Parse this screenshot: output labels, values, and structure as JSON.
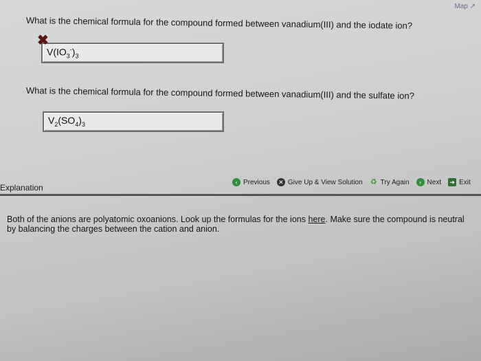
{
  "header": {
    "map_label": "Map"
  },
  "questions": [
    {
      "prompt": "What is the chemical formula for the compound formed between vanadium(III) and the iodate ion?",
      "answer": {
        "base": "V(IO",
        "sub1": "3",
        "sup": "-",
        "mid": ")",
        "sub2": "3"
      },
      "status": "incorrect"
    },
    {
      "prompt": "What is the chemical formula for the compound formed between vanadium(III) and the sulfate ion?",
      "answer": {
        "base": "V",
        "sub1": "2",
        "mid": "(SO",
        "sub2": "4",
        "end": ")",
        "sub3": "3"
      },
      "status": "unanswered"
    }
  ],
  "toolbar": {
    "previous_label": "Previous",
    "give_up_label": "Give Up & View Solution",
    "try_again_label": "Try Again",
    "next_label": "Next",
    "exit_label": "Exit"
  },
  "explanation": {
    "heading": "Explanation",
    "text_before_link": "Both of the anions are polyatomic oxoanions. Look up the formulas for the ions ",
    "link_text": "here",
    "text_after_link": ". Make sure the compound is neutral by balancing the charges between the cation and anion."
  },
  "colors": {
    "previous_icon": "#2f8f3a",
    "give_up_icon": "#333333",
    "try_again_icon": "#3a8f2a",
    "next_icon": "#2f8f3a",
    "exit_icon": "#2f6f2f"
  },
  "icons": {
    "previous": "arrow-left-circle-icon",
    "give_up": "x-circle-icon",
    "try_again": "recycle-icon",
    "next": "arrow-right-circle-icon",
    "exit": "exit-arrow-icon",
    "wrong": "red-x-icon"
  }
}
